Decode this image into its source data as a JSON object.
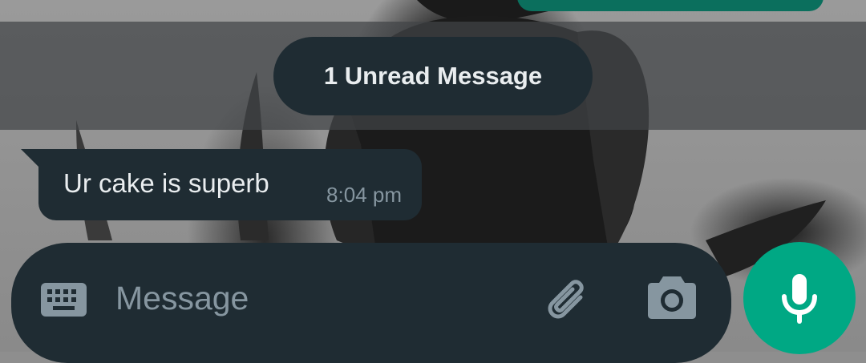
{
  "unread_banner": {
    "label": "1 Unread Message"
  },
  "messages": [
    {
      "text": "Ur cake is superb",
      "time": "8:04 pm",
      "direction": "incoming"
    }
  ],
  "composer": {
    "placeholder": "Message",
    "value": "",
    "left_icon": "keyboard-icon",
    "attach_icon": "paperclip-icon",
    "camera_icon": "camera-icon",
    "send_icon": "mic-icon"
  },
  "colors": {
    "bubble": "#1f2c33",
    "accent": "#00a884",
    "text_primary": "#e9edef",
    "text_secondary": "#8696a0"
  }
}
